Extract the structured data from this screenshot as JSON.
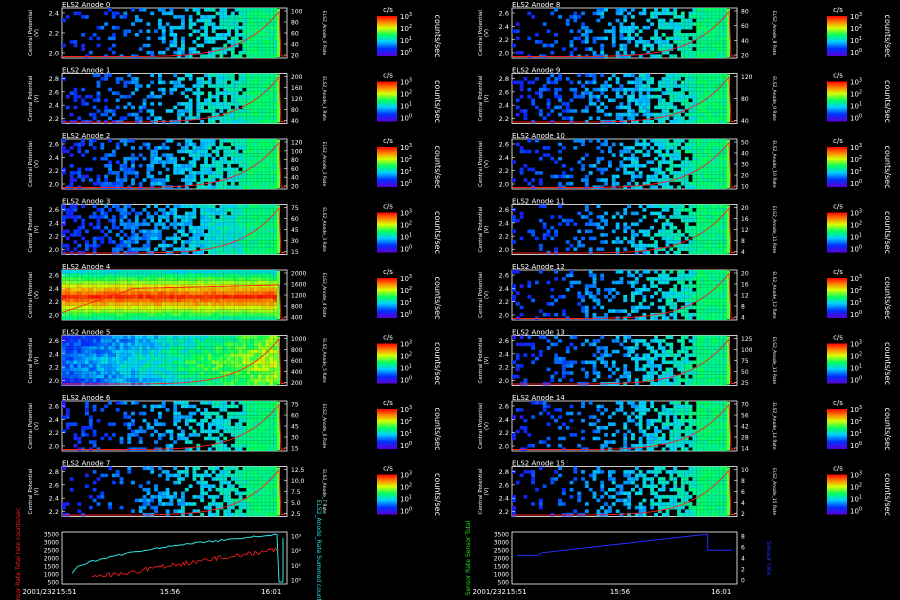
{
  "chart_data": {
    "type": "heatmap",
    "instrument": "ELS2",
    "unit_colorbar": "c/s",
    "unit_side": "counts/sec",
    "ylabel_left": "Central Potential",
    "ylabel_left_unit": "(V)",
    "colorbar_ticks": [
      "10°",
      "10¹",
      "10²",
      "10³"
    ],
    "colorbar_ticks_sup": [
      "0",
      "1",
      "2",
      "3"
    ],
    "panels": [
      {
        "title": "ELS2 Anode 0",
        "yticks": [
          "2.4",
          "2.2",
          "2.0"
        ],
        "ylim": [
          1.9,
          2.5
        ],
        "rticks": [
          "100",
          "80",
          "60",
          "40",
          "20"
        ],
        "rlabel": "ELS2_Anode_0 Rate",
        "intensity": 0.18,
        "band": 0.0
      },
      {
        "title": "ELS2 Anode 1",
        "yticks": [
          "2.8",
          "2.6",
          "2.4",
          "2.2"
        ],
        "ylim": [
          2.1,
          2.9
        ],
        "rticks": [
          "200",
          "160",
          "120",
          "80",
          "40"
        ],
        "rlabel": "ELS2_Anode_1 Rate",
        "intensity": 0.25,
        "band": 0.0
      },
      {
        "title": "ELS2 Anode 2",
        "yticks": [
          "2.6",
          "2.4",
          "2.2",
          "2.0"
        ],
        "ylim": [
          1.9,
          2.7
        ],
        "rticks": [
          "120",
          "100",
          "80",
          "60",
          "40",
          "20"
        ],
        "rlabel": "ELS2_Anode_2 Rate",
        "intensity": 0.32,
        "band": 0.0
      },
      {
        "title": "ELS2 Anode 3",
        "yticks": [
          "2.6",
          "2.4",
          "2.2",
          "2.0"
        ],
        "ylim": [
          1.9,
          2.7
        ],
        "rticks": [
          "75",
          "60",
          "45",
          "30",
          "15"
        ],
        "rlabel": "ELS2_Anode_3 Rate",
        "intensity": 0.45,
        "band": 0.0
      },
      {
        "title": "ELS2 Anode 4",
        "yticks": [
          "2.6",
          "2.4",
          "2.2",
          "2.0"
        ],
        "ylim": [
          1.9,
          2.7
        ],
        "rticks": [
          "2000",
          "1600",
          "1200",
          "800",
          "400"
        ],
        "rlabel": "ELS2_Anode_4 Rate",
        "intensity": 0.95,
        "band": 1.0
      },
      {
        "title": "ELS2 Anode 5",
        "yticks": [
          "2.6",
          "2.4",
          "2.2",
          "2.0"
        ],
        "ylim": [
          1.9,
          2.7
        ],
        "rticks": [
          "1000",
          "800",
          "600",
          "400",
          "200"
        ],
        "rlabel": "ELS2_Anode_5 Rate",
        "intensity": 0.6,
        "band": 0.5
      },
      {
        "title": "ELS2 Anode 6",
        "yticks": [
          "2.6",
          "2.4",
          "2.2",
          "2.0"
        ],
        "ylim": [
          1.9,
          2.7
        ],
        "rticks": [
          "75",
          "60",
          "45",
          "30",
          "15"
        ],
        "rlabel": "ELS2_Anode_6 Rate",
        "intensity": 0.2,
        "band": 0.0
      },
      {
        "title": "ELS2 Anode 7",
        "yticks": [
          "2.8",
          "2.6",
          "2.4",
          "2.2"
        ],
        "ylim": [
          2.1,
          2.9
        ],
        "rticks": [
          "12.5",
          "10.0",
          "7.5",
          "5.0",
          "2.5"
        ],
        "rlabel": "ELS2_Anode_7 Rate",
        "intensity": 0.15,
        "band": 0.0
      },
      {
        "title": "ELS2 Anode 8",
        "yticks": [
          "2.6",
          "2.4",
          "2.2",
          "2.0"
        ],
        "ylim": [
          1.9,
          2.7
        ],
        "rticks": [
          "80",
          "60",
          "40",
          "20"
        ],
        "rlabel": "ELS2_Anode_8 Rate",
        "intensity": 0.2,
        "band": 0.0
      },
      {
        "title": "ELS2 Anode 9",
        "yticks": [
          "2.8",
          "2.6",
          "2.4",
          "2.2"
        ],
        "ylim": [
          2.1,
          2.9
        ],
        "rticks": [
          "120",
          "80",
          "40"
        ],
        "rlabel": "ELS2_Anode_9 Rate",
        "intensity": 0.25,
        "band": 0.0
      },
      {
        "title": "ELS2 Anode 10",
        "yticks": [
          "2.6",
          "2.4",
          "2.2",
          "2.0"
        ],
        "ylim": [
          1.9,
          2.7
        ],
        "rticks": [
          "50",
          "40",
          "30",
          "20",
          "10"
        ],
        "rlabel": "ELS2_Anode_10 Rate",
        "intensity": 0.2,
        "band": 0.0
      },
      {
        "title": "ELS2 Anode 11",
        "yticks": [
          "2.6",
          "2.4",
          "2.2",
          "2.0"
        ],
        "ylim": [
          1.9,
          2.7
        ],
        "rticks": [
          "20",
          "16",
          "12",
          "8",
          "4"
        ],
        "rlabel": "ELS2_Anode_11 Rate",
        "intensity": 0.15,
        "band": 0.0
      },
      {
        "title": "ELS2 Anode 12",
        "yticks": [
          "2.6",
          "2.4",
          "2.2",
          "2.0"
        ],
        "ylim": [
          1.9,
          2.7
        ],
        "rticks": [
          "20",
          "16",
          "12",
          "8",
          "4"
        ],
        "rlabel": "ELS2_Anode_12 Rate",
        "intensity": 0.15,
        "band": 0.0
      },
      {
        "title": "ELS2 Anode 13",
        "yticks": [
          "2.6",
          "2.4",
          "2.2",
          "2.0"
        ],
        "ylim": [
          1.9,
          2.7
        ],
        "rticks": [
          "125",
          "100",
          "75",
          "50",
          "25"
        ],
        "rlabel": "ELS2_Anode_13 Rate",
        "intensity": 0.2,
        "band": 0.0
      },
      {
        "title": "ELS2 Anode 14",
        "yticks": [
          "2.6",
          "2.4",
          "2.2",
          "2.0"
        ],
        "ylim": [
          1.9,
          2.7
        ],
        "rticks": [
          "70",
          "56",
          "42",
          "28",
          "14"
        ],
        "rlabel": "ELS2_Anode_14 Rate",
        "intensity": 0.2,
        "band": 0.0
      },
      {
        "title": "ELS2 Anode 15",
        "yticks": [
          "2.8",
          "2.6",
          "2.4",
          "2.2"
        ],
        "ylim": [
          2.1,
          2.9
        ],
        "rticks": [
          "10",
          "8",
          "6",
          "4",
          "2"
        ],
        "rlabel": "ELS2_Anode_15 Rate",
        "intensity": 0.15,
        "band": 0.0
      }
    ],
    "bottom_left": {
      "yticks_left": [
        "3500",
        "3000",
        "2500",
        "2000",
        "1500",
        "1000",
        "500"
      ],
      "yticks_right": [
        "10³",
        "10²",
        "10¹",
        "10⁰"
      ],
      "ylabel_left": "Sensor Rate Total rate counts/sec",
      "ylabel_right": "ELS2_Anode_Rate Summed counts/sec",
      "xticks": [
        "15:51",
        "15:56",
        "16:01"
      ],
      "date_label": "2001/232",
      "series": [
        {
          "name": "Total",
          "color": "#ff2020"
        },
        {
          "name": "Summed",
          "color": "#30e0e0"
        }
      ]
    },
    "bottom_right": {
      "yticks_left": [
        "3500",
        "3000",
        "2500",
        "2000",
        "1500",
        "1000",
        "500"
      ],
      "yticks_right": [
        "8",
        "6",
        "4",
        "2",
        "0"
      ],
      "ylabel_left": "Sensor Rate Sensor Total",
      "ylabel_right": "Sensor rate",
      "xticks": [
        "15:51",
        "15:56",
        "16:01"
      ],
      "date_label": "2001/232",
      "series": [
        {
          "name": "Sensor Total",
          "color": "#2030ff"
        }
      ]
    }
  }
}
